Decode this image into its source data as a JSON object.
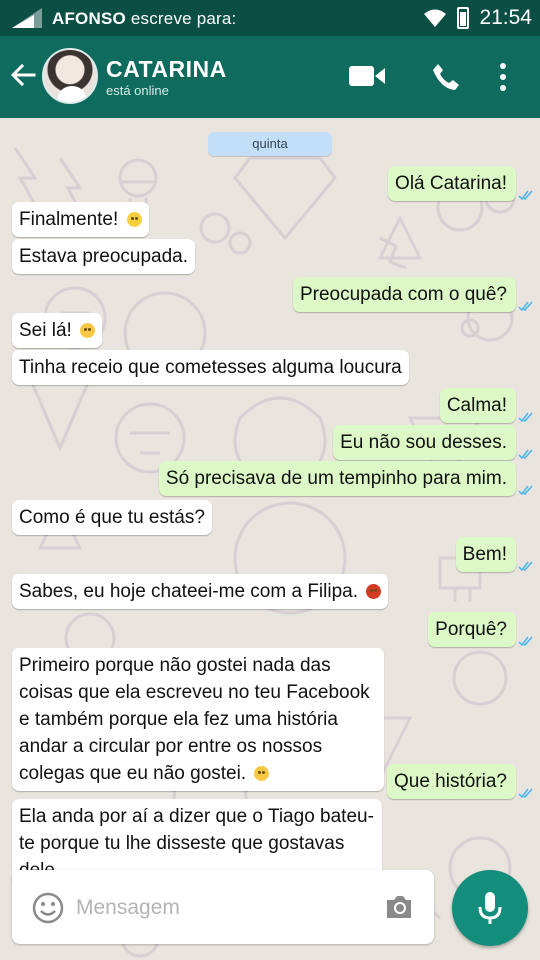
{
  "statusbar": {
    "sender_name": "AFONSO",
    "sender_suffix": "escreve para:",
    "time": "21:54"
  },
  "header": {
    "contact_name": "CATARINA",
    "contact_status": "está online",
    "icons": [
      "back-arrow-icon",
      "video-call-icon",
      "phone-icon",
      "more-vert-icon"
    ]
  },
  "chat": {
    "date_separator": "quinta",
    "messages": [
      {
        "dir": "out",
        "text": "Olá Catarina!"
      },
      {
        "dir": "in",
        "text": "Finalmente!",
        "emoji": "smile"
      },
      {
        "dir": "in",
        "text": "Estava preocupada."
      },
      {
        "dir": "out",
        "text": "Preocupada com o quê?"
      },
      {
        "dir": "in",
        "text": "Sei lá!",
        "emoji": "blush"
      },
      {
        "dir": "in",
        "text": "Tinha receio que cometesses alguma loucura"
      },
      {
        "dir": "out",
        "text": "Calma!"
      },
      {
        "dir": "out",
        "text": "Eu não sou desses."
      },
      {
        "dir": "out",
        "text": "Só precisava de um tempinho para mim."
      },
      {
        "dir": "in",
        "text": "Como é que tu estás?"
      },
      {
        "dir": "out",
        "text": "Bem!"
      },
      {
        "dir": "in",
        "text": "Sabes, eu hoje chateei-me com a Filipa.",
        "emoji": "angry"
      },
      {
        "dir": "out",
        "text": "Porquê?"
      },
      {
        "dir": "in",
        "text": "Primeiro porque não gostei nada das coisas que ela escreveu no teu Facebook e também porque ela fez uma história andar a circular por entre os nossos colegas que eu não gostei.",
        "emoji": "blush"
      },
      {
        "dir": "out",
        "text": "Que história?"
      },
      {
        "dir": "in",
        "text": "Ela anda por aí a dizer que o Tiago bateu-te porque tu lhe disseste que gostavas dele"
      }
    ]
  },
  "composer": {
    "placeholder": "Mensagem",
    "icons": [
      "emoji-icon",
      "camera-icon",
      "microphone-icon"
    ]
  },
  "colors": {
    "statusbar": "#0b4f44",
    "header": "#0e6b5d",
    "outgoing_bubble": "#dcf8c6",
    "incoming_bubble": "#ffffff",
    "mic_button": "#138d7c",
    "read_ticks": "#4fb6ec"
  }
}
